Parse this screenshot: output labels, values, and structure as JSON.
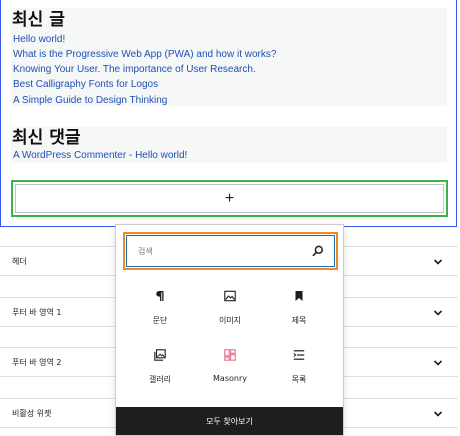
{
  "recent_posts": {
    "heading": "최신 글",
    "items": [
      "Hello world!",
      "What is the Progressive Web App (PWA) and how it works?",
      "Knowing Your User. The importance of User Research.",
      "Best Calligraphy Fonts for Logos",
      "A Simple Guide to Design Thinking"
    ]
  },
  "recent_comments": {
    "heading": "최신 댓글",
    "items": [
      "A WordPress Commenter - Hello world!"
    ]
  },
  "appender": {
    "icon": "plus-icon",
    "symbol": "+"
  },
  "panels": [
    {
      "label": "헤더"
    },
    {
      "label": "푸터 바 영역 1"
    },
    {
      "label": "푸터 바 영역 2"
    },
    {
      "label": "비활성 위젯"
    }
  ],
  "inserter": {
    "search": {
      "placeholder": "검색",
      "value": ""
    },
    "blocks": [
      {
        "label": "문단",
        "icon": "paragraph-icon"
      },
      {
        "label": "이미지",
        "icon": "image-icon"
      },
      {
        "label": "제목",
        "icon": "bookmark-icon"
      },
      {
        "label": "갤러리",
        "icon": "gallery-icon"
      },
      {
        "label": "Masonry",
        "icon": "masonry-grid-icon"
      },
      {
        "label": "목록",
        "icon": "list-icon"
      }
    ],
    "browse_all_label": "모두 찾아보기"
  },
  "colors": {
    "selection_outline": "#3858e9",
    "appender_outline": "#3bb34a",
    "search_highlight": "#f08a24",
    "search_border": "#1b6fb3",
    "link": "#1e50b4",
    "masonry_icon": "#e26f8b",
    "browse_all_bg": "#1e1e1e"
  }
}
